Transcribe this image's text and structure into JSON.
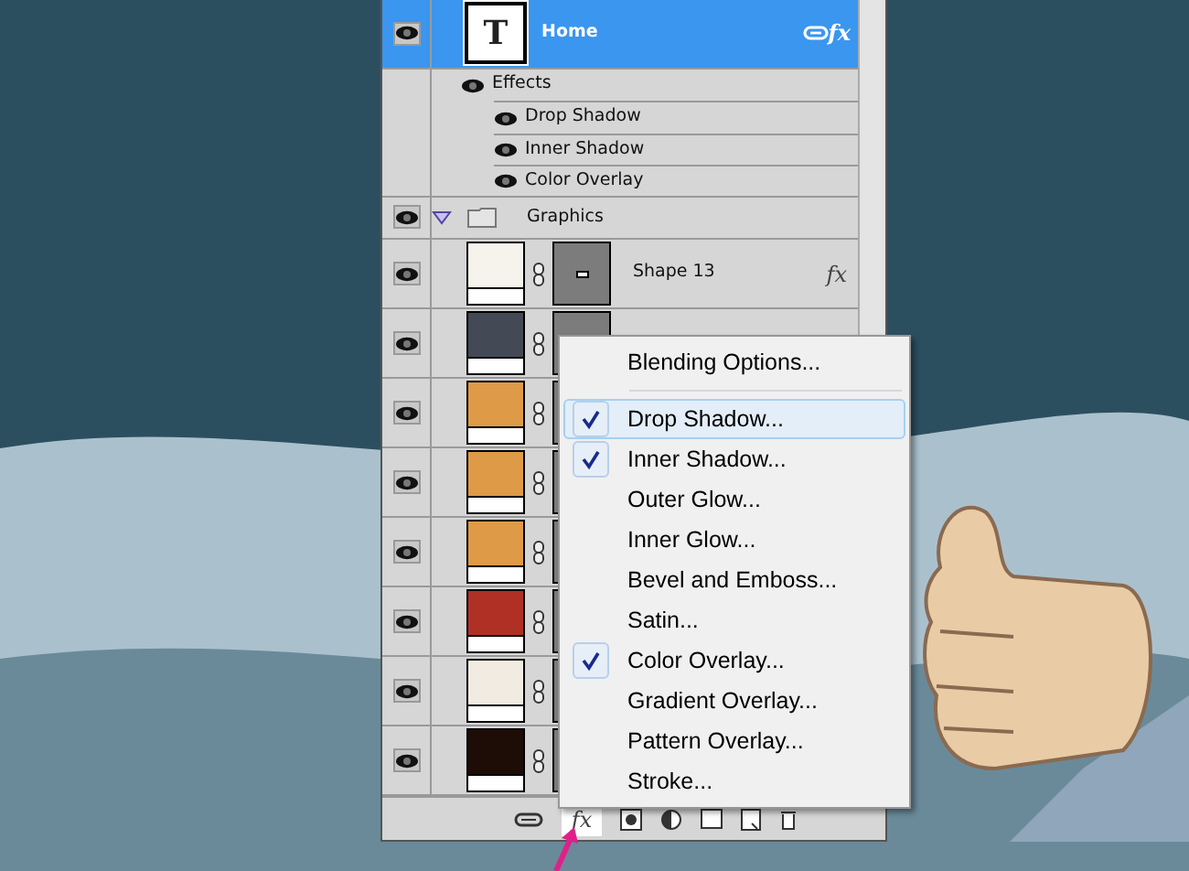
{
  "layers_panel": {
    "layers": [
      {
        "kind": "text",
        "name": "Home",
        "glyph": "T",
        "selected": true,
        "linked": true,
        "fx": "fx",
        "effects_label": "Effects",
        "effects": [
          "Drop Shadow",
          "Inner Shadow",
          "Color Overlay"
        ]
      },
      {
        "kind": "group",
        "name": "Graphics",
        "selected": false,
        "expanded": true,
        "children": [
          {
            "kind": "shape",
            "name": "Shape 13",
            "selected": false,
            "color": "#f6f3ec",
            "fx": "fx"
          },
          {
            "kind": "shape",
            "selected": false,
            "color": "#434a55"
          },
          {
            "kind": "shape",
            "selected": false,
            "color": "#de9a46"
          },
          {
            "kind": "shape",
            "selected": false,
            "color": "#de9a46"
          },
          {
            "kind": "shape",
            "selected": false,
            "color": "#de9a46"
          },
          {
            "kind": "shape",
            "selected": false,
            "color": "#b03025"
          },
          {
            "kind": "shape",
            "selected": false,
            "color": "#f2ebe1"
          },
          {
            "kind": "shape",
            "selected": false,
            "color": "#1e0c06"
          }
        ]
      }
    ],
    "toolbar": {
      "fx_label": "fx"
    }
  },
  "effects_menu": {
    "items": [
      {
        "kind": "command",
        "label": "Blending Options...",
        "checked": false,
        "selected": false
      },
      {
        "kind": "effect",
        "label": "Drop Shadow...",
        "checked": true,
        "selected": true
      },
      {
        "kind": "effect",
        "label": "Inner Shadow...",
        "checked": true,
        "selected": false
      },
      {
        "kind": "effect",
        "label": "Outer Glow...",
        "checked": false,
        "selected": false
      },
      {
        "kind": "effect",
        "label": "Inner Glow...",
        "checked": false,
        "selected": false
      },
      {
        "kind": "effect",
        "label": "Bevel and Emboss...",
        "checked": false,
        "selected": false
      },
      {
        "kind": "effect",
        "label": "Satin...",
        "checked": false,
        "selected": false
      },
      {
        "kind": "effect",
        "label": "Color Overlay...",
        "checked": true,
        "selected": false
      },
      {
        "kind": "effect",
        "label": "Gradient Overlay...",
        "checked": false,
        "selected": false
      },
      {
        "kind": "effect",
        "label": "Pattern Overlay...",
        "checked": false,
        "selected": false
      },
      {
        "kind": "effect",
        "label": "Stroke...",
        "checked": false,
        "selected": false
      }
    ]
  }
}
